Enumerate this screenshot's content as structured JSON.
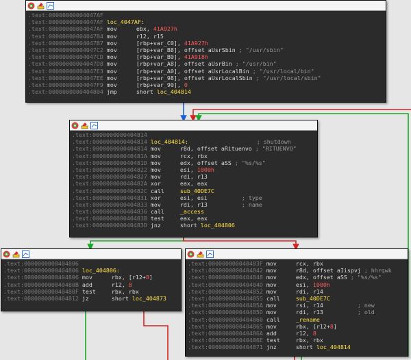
{
  "blocks": [
    {
      "id": "b1",
      "lines": [
        {
          "addr": ".text:00000000004047AF",
          "mnem": "",
          "ops": []
        },
        {
          "addr": ".text:00000000004047AF",
          "mnem": "",
          "ops": [
            {
              "t": "loc_4047AF:",
              "c": "lbl"
            }
          ]
        },
        {
          "addr": ".text:00000000004047AF",
          "mnem": "mov",
          "ops": [
            {
              "t": "ebx, "
            },
            {
              "t": "41A927h",
              "c": "num"
            }
          ]
        },
        {
          "addr": ".text:00000000004047B4",
          "mnem": "mov",
          "ops": [
            {
              "t": "r12, r15"
            }
          ]
        },
        {
          "addr": ".text:00000000004047B7",
          "mnem": "mov",
          "ops": [
            {
              "t": "[rbp+var_C0], "
            },
            {
              "t": "41A927h",
              "c": "num"
            }
          ]
        },
        {
          "addr": ".text:00000000004047C2",
          "mnem": "mov",
          "ops": [
            {
              "t": "[rbp+var_B8], offset aUsrSbin "
            },
            {
              "t": "; \"/usr/sbin\"",
              "c": "cmt"
            }
          ]
        },
        {
          "addr": ".text:00000000004047CD",
          "mnem": "mov",
          "ops": [
            {
              "t": "[rbp+var_B0], "
            },
            {
              "t": "41A918h",
              "c": "num"
            }
          ]
        },
        {
          "addr": ".text:00000000004047D8",
          "mnem": "mov",
          "ops": [
            {
              "t": "[rbp+var_A8], offset aUsrBin "
            },
            {
              "t": "; \"/usr/bin\"",
              "c": "cmt"
            }
          ]
        },
        {
          "addr": ".text:00000000004047E3",
          "mnem": "mov",
          "ops": [
            {
              "t": "[rbp+var_A0], offset aUsrLocalBin "
            },
            {
              "t": "; \"/usr/local/bin\"",
              "c": "cmt"
            }
          ]
        },
        {
          "addr": ".text:00000000004047EE",
          "mnem": "mov",
          "ops": [
            {
              "t": "[rbp+var_98], offset aUsrLocalSbin "
            },
            {
              "t": "; \"/usr/local/sbin\"",
              "c": "cmt"
            }
          ]
        },
        {
          "addr": ".text:00000000004047F9",
          "mnem": "mov",
          "ops": [
            {
              "t": "[rbp+var_90], "
            },
            {
              "t": "0",
              "c": "num"
            }
          ]
        },
        {
          "addr": ".text:0000000000404804",
          "mnem": "jmp",
          "ops": [
            {
              "t": "short "
            },
            {
              "t": "loc_404814",
              "c": "lbl"
            }
          ]
        }
      ]
    },
    {
      "id": "b2",
      "lines": [
        {
          "addr": ".text:0000000000404814",
          "mnem": "",
          "ops": []
        },
        {
          "addr": ".text:0000000000404814",
          "mnem": "",
          "ops": [
            {
              "t": "loc_404814:",
              "c": "lbl"
            },
            {
              "t": "                    ; shutdown",
              "c": "cmt"
            }
          ]
        },
        {
          "addr": ".text:0000000000404814",
          "mnem": "mov",
          "ops": [
            {
              "t": "r8d, offset aRituenvo "
            },
            {
              "t": "; \"RITUENVO\"",
              "c": "cmt"
            }
          ]
        },
        {
          "addr": ".text:000000000040481A",
          "mnem": "mov",
          "ops": [
            {
              "t": "rcx, rbx"
            }
          ]
        },
        {
          "addr": ".text:000000000040481D",
          "mnem": "mov",
          "ops": [
            {
              "t": "edx, offset aSS "
            },
            {
              "t": "; \"%s/%s\"",
              "c": "cmt"
            }
          ]
        },
        {
          "addr": ".text:0000000000404822",
          "mnem": "mov",
          "ops": [
            {
              "t": "esi, "
            },
            {
              "t": "1000h",
              "c": "num"
            }
          ]
        },
        {
          "addr": ".text:0000000000404827",
          "mnem": "mov",
          "ops": [
            {
              "t": "rdi, r13"
            }
          ]
        },
        {
          "addr": ".text:000000000040482A",
          "mnem": "xor",
          "ops": [
            {
              "t": "eax, eax"
            }
          ]
        },
        {
          "addr": ".text:000000000040482C",
          "mnem": "call",
          "ops": [
            {
              "t": "sub_40DE7C",
              "c": "lbl"
            }
          ]
        },
        {
          "addr": ".text:0000000000404831",
          "mnem": "xor",
          "ops": [
            {
              "t": "esi, esi          "
            },
            {
              "t": "; type",
              "c": "cmt"
            }
          ]
        },
        {
          "addr": ".text:0000000000404833",
          "mnem": "mov",
          "ops": [
            {
              "t": "rdi, r13          "
            },
            {
              "t": "; name",
              "c": "cmt"
            }
          ]
        },
        {
          "addr": ".text:0000000000404836",
          "mnem": "call",
          "ops": [
            {
              "t": "_access",
              "c": "lbl"
            }
          ]
        },
        {
          "addr": ".text:000000000040483B",
          "mnem": "test",
          "ops": [
            {
              "t": "eax, eax"
            }
          ]
        },
        {
          "addr": ".text:000000000040483D",
          "mnem": "jnz",
          "ops": [
            {
              "t": "short "
            },
            {
              "t": "loc_404806",
              "c": "lbl"
            }
          ]
        }
      ]
    },
    {
      "id": "b3",
      "lines": [
        {
          "addr": ".text:0000000000404806",
          "mnem": "",
          "ops": []
        },
        {
          "addr": ".text:0000000000404806",
          "mnem": "",
          "ops": [
            {
              "t": "loc_404806:",
              "c": "lbl"
            }
          ]
        },
        {
          "addr": ".text:0000000000404806",
          "mnem": "mov",
          "ops": [
            {
              "t": "rbx, [r12+"
            },
            {
              "t": "8",
              "c": "num"
            },
            {
              "t": "]"
            }
          ]
        },
        {
          "addr": ".text:000000000040480B",
          "mnem": "add",
          "ops": [
            {
              "t": "r12, "
            },
            {
              "t": "8",
              "c": "num"
            }
          ]
        },
        {
          "addr": ".text:000000000040480F",
          "mnem": "test",
          "ops": [
            {
              "t": "rbx, rbx"
            }
          ]
        },
        {
          "addr": ".text:0000000000404812",
          "mnem": "jz",
          "ops": [
            {
              "t": "short "
            },
            {
              "t": "loc_404873",
              "c": "lbl"
            }
          ]
        }
      ]
    },
    {
      "id": "b4",
      "lines": [
        {
          "addr": ".text:000000000040483F",
          "mnem": "mov",
          "ops": [
            {
              "t": "rcx, rbx"
            }
          ]
        },
        {
          "addr": ".text:0000000000404842",
          "mnem": "mov",
          "ops": [
            {
              "t": "r8d, offset aIispvj "
            },
            {
              "t": "; hhrqwk",
              "c": "cmt"
            }
          ]
        },
        {
          "addr": ".text:0000000000404848",
          "mnem": "mov",
          "ops": [
            {
              "t": "edx, offset aSS "
            },
            {
              "t": "; \"%s/%s\"",
              "c": "cmt"
            }
          ]
        },
        {
          "addr": ".text:000000000040484D",
          "mnem": "mov",
          "ops": [
            {
              "t": "esi, "
            },
            {
              "t": "1000h",
              "c": "num"
            }
          ]
        },
        {
          "addr": ".text:0000000000404852",
          "mnem": "mov",
          "ops": [
            {
              "t": "rdi, r14"
            }
          ]
        },
        {
          "addr": ".text:0000000000404855",
          "mnem": "call",
          "ops": [
            {
              "t": "sub_40DE7C",
              "c": "lbl"
            }
          ]
        },
        {
          "addr": ".text:000000000040485A",
          "mnem": "mov",
          "ops": [
            {
              "t": "rsi, r14          "
            },
            {
              "t": "; new",
              "c": "cmt"
            }
          ]
        },
        {
          "addr": ".text:000000000040485D",
          "mnem": "mov",
          "ops": [
            {
              "t": "rdi, r13          "
            },
            {
              "t": "; old",
              "c": "cmt"
            }
          ]
        },
        {
          "addr": ".text:0000000000404860",
          "mnem": "call",
          "ops": [
            {
              "t": "_rename",
              "c": "lbl"
            }
          ]
        },
        {
          "addr": ".text:0000000000404865",
          "mnem": "mov",
          "ops": [
            {
              "t": "rbx, [r12+"
            },
            {
              "t": "8",
              "c": "num"
            },
            {
              "t": "]"
            }
          ]
        },
        {
          "addr": ".text:000000000040486A",
          "mnem": "add",
          "ops": [
            {
              "t": "r12, "
            },
            {
              "t": "8",
              "c": "num"
            }
          ]
        },
        {
          "addr": ".text:000000000040486E",
          "mnem": "test",
          "ops": [
            {
              "t": "rbx, rbx"
            }
          ]
        },
        {
          "addr": ".text:0000000000404871",
          "mnem": "jnz",
          "ops": [
            {
              "t": "short "
            },
            {
              "t": "loc_404814",
              "c": "lbl"
            }
          ]
        }
      ]
    }
  ],
  "colors": {
    "edge_true": "#1fa62a",
    "edge_false": "#d42323",
    "edge_uncond": "#1b5fd8",
    "label": "#ffe04a",
    "number": "#ff5a5a",
    "address": "#7b7b7b"
  }
}
